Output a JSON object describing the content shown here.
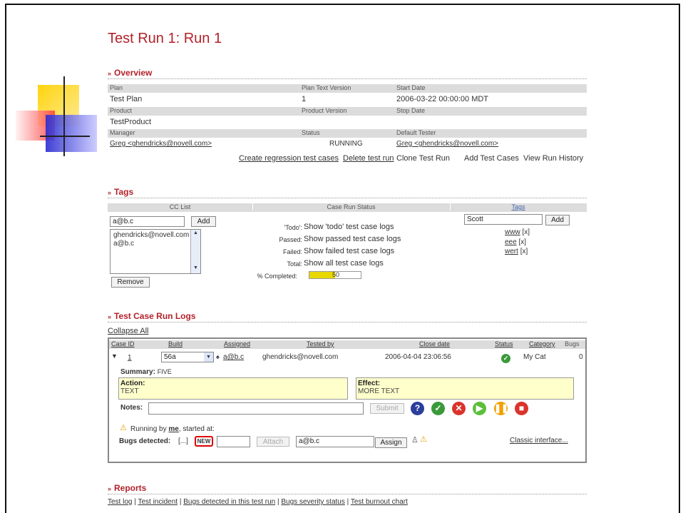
{
  "title": "Test Run 1: Run 1",
  "overview": {
    "heading": "Overview",
    "row1_labels": [
      "Plan",
      "Plan Text Version",
      "Start Date"
    ],
    "row1_values": [
      "Test Plan",
      "1",
      "2006-03-22 00:00:00 MDT"
    ],
    "row2_labels": [
      "Product",
      "Product Version",
      "Stop Date"
    ],
    "row2_values": [
      "TestProduct",
      "",
      ""
    ],
    "row3_labels": [
      "Manager",
      "Status",
      "Default Tester"
    ],
    "manager": "Greg <ghendricks@novell.com>",
    "status": "RUNNING",
    "default_tester": "Greg <ghendricks@novell.com>",
    "actions": {
      "create_regression": "Create regression test cases",
      "delete_run": "Delete test run",
      "clone_run": "Clone Test Run",
      "add_cases": "Add Test Cases",
      "view_history": "View Run History"
    }
  },
  "tags": {
    "heading": "Tags",
    "cc_header": "CC List",
    "status_header": "Case Run Status",
    "tags_header": "Tags",
    "cc_input": "a@b.c",
    "add_label": "Add",
    "cc_list": [
      "ghendricks@novell.com",
      "a@b.c"
    ],
    "remove_label": "Remove",
    "status_rows": [
      {
        "label": "'Todo':",
        "value": "Show 'todo' test case logs"
      },
      {
        "label": "Passed:",
        "value": "Show passed test case logs"
      },
      {
        "label": "Failed:",
        "value": "Show failed test case logs"
      },
      {
        "label": "Total:",
        "value": "Show all test case logs"
      }
    ],
    "completed_label": "% Completed:",
    "completed_value": "50",
    "completed_fraction": 0.5,
    "tag_input": "Scott",
    "tag_items": [
      {
        "name": "www",
        "remove": "[x]"
      },
      {
        "name": "eee",
        "remove": "[x]"
      },
      {
        "name": "wert",
        "remove": "[x]"
      }
    ]
  },
  "logs": {
    "heading": "Test Case Run Logs",
    "collapse_all": "Collapse All",
    "headers": [
      "Case ID",
      "Build",
      "Assigned",
      "Tested by",
      "Close date",
      "Status",
      "Category",
      "Bugs"
    ],
    "row": {
      "case_id": "1",
      "build": "56a",
      "assigned": "a@b.c",
      "tested_by": "ghendricks@novell.com",
      "close_date": "2006-04-04 23:06:56",
      "category": "My Cat",
      "bugs": "0"
    },
    "summary_label": "Summary:",
    "summary_value": "FIVE",
    "action_label": "Action:",
    "action_value": "TEXT",
    "effect_label": "Effect:",
    "effect_value": "MORE TEXT",
    "notes_label": "Notes:",
    "submit_label": "Submit",
    "running_pre": "Running by ",
    "running_user": "me",
    "running_post": ", started at:",
    "bugs_label": "Bugs detected:",
    "bugs_ellipsis": "[...]",
    "new_badge": "NEW",
    "attach_label": "Attach",
    "assign_input": "a@b.c",
    "assign_label": "Assign",
    "classic_link": "Classic interface..."
  },
  "reports": {
    "heading": "Reports",
    "links": [
      "Test log",
      "Test incident",
      "Bugs detected in this test run",
      "Bugs severity status",
      "Test burnout chart"
    ],
    "sep": "|"
  },
  "colors": {
    "accent": "#b3222a",
    "header_grey": "#dcdcdc",
    "yellow_box": "#ffffcc",
    "progress": "#e8d800"
  }
}
